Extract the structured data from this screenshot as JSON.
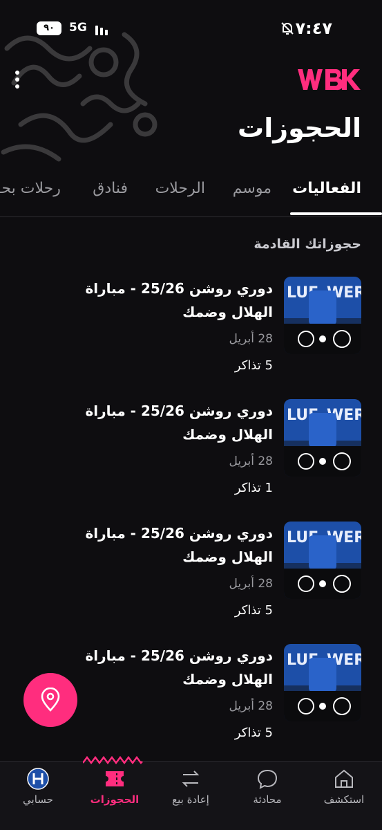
{
  "status_bar": {
    "time": "٧:٤٧",
    "battery": "٩٠",
    "network": "5G"
  },
  "header": {
    "logo_text": "WBK",
    "title": "الحجوزات"
  },
  "tabs": [
    {
      "label": "الفعاليات",
      "active": true
    },
    {
      "label": "موسم",
      "active": false
    },
    {
      "label": "الرحلات",
      "active": false
    },
    {
      "label": "فنادق",
      "active": false
    },
    {
      "label": "رحلات بحـ",
      "active": false
    }
  ],
  "section_title": "حجوزاتك القادمة",
  "bookings": [
    {
      "title": "دوري روشن 25/26 - مباراة الهلال وضمك",
      "date": "28 أبريل",
      "tickets": "5 تذاكر"
    },
    {
      "title": "دوري روشن 25/26 - مباراة الهلال وضمك",
      "date": "28 أبريل",
      "tickets": "1 تذاكر"
    },
    {
      "title": "دوري روشن 25/26 - مباراة الهلال وضمك",
      "date": "28 أبريل",
      "tickets": "5 تذاكر"
    },
    {
      "title": "دوري روشن 25/26 - مباراة الهلال وضمك",
      "date": "28 أبريل",
      "tickets": "5 تذاكر"
    }
  ],
  "bottom_nav": [
    {
      "label": "استكشف",
      "icon": "home-icon"
    },
    {
      "label": "محادثة",
      "icon": "chat-icon"
    },
    {
      "label": "إعادة بيع",
      "icon": "resale-icon"
    },
    {
      "label": "الحجوزات",
      "icon": "ticket-icon",
      "active": true
    },
    {
      "label": "حسابي",
      "icon": "avatar-icon"
    }
  ],
  "colors": {
    "accent": "#ff2d7e",
    "background": "#0e0d10",
    "text_muted": "#9a9a9f"
  }
}
